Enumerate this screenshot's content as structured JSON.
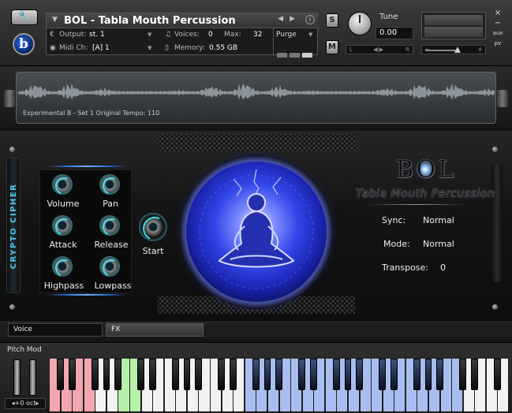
{
  "header": {
    "wrench_icon": "wrench-icon",
    "logo_letter": "b",
    "instrument_title": "BOL - Tabla Mouth Percussion",
    "output_label": "Output:",
    "output_value": "st. 1",
    "voices_label": "Voices:",
    "voices_value": "0",
    "max_label": "Max:",
    "max_value": "32",
    "purge_label": "Purge",
    "midi_label": "Midi Ch:",
    "midi_value": "[A] 1",
    "memory_label": "Memory:",
    "memory_value": "0.55 GB",
    "solo_label": "S",
    "mute_label": "M",
    "tune_label": "Tune",
    "tune_value": "0.00",
    "pan_left": "L",
    "pan_center": "◀|▶",
    "pan_right": "R",
    "vol_minus": "−",
    "vol_plus": "+",
    "close_label": "×",
    "minimize_label": "−",
    "aux_label": "aux",
    "pv_label": "pv"
  },
  "waveform": {
    "caption": "Experimental B - Set 1   Original Tempo: 110"
  },
  "panel": {
    "side_label": "CRYPTO CIPHER",
    "knobs": [
      {
        "label": "Volume"
      },
      {
        "label": "Pan"
      },
      {
        "label": "Attack"
      },
      {
        "label": "Release"
      },
      {
        "label": "Highpass"
      },
      {
        "label": "Lowpass"
      }
    ],
    "start_label": "Start",
    "logo_title": "BOL",
    "logo_subtitle": "Tabla Mouth Percussion",
    "sync_label": "Sync:",
    "sync_value": "Normal",
    "mode_label": "Mode:",
    "mode_value": "Normal",
    "transpose_label": "Transpose:",
    "transpose_value": "0"
  },
  "tabs": [
    "Voice",
    "FX"
  ],
  "keyboard": {
    "pitch_mod_label": "Pitch Mod",
    "octave_label": "◂+0 oct▸",
    "colors": {
      "pink": "#f4a6ae",
      "green": "#b6f0a8",
      "blue": "#a9bef0",
      "white": "#f2f2f2"
    }
  }
}
